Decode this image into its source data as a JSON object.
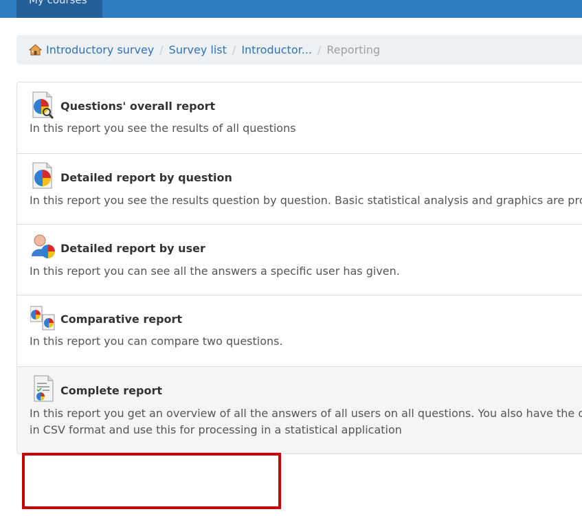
{
  "topbar": {
    "tab_label": "My courses"
  },
  "breadcrumb": {
    "items": [
      {
        "label": "Introductory survey",
        "icon": "home-icon"
      },
      {
        "label": "Survey list"
      },
      {
        "label": "Introductor..."
      },
      {
        "label": "Reporting"
      }
    ]
  },
  "reports": [
    {
      "icon": "pie-chart-magnifier-icon",
      "title": "Questions' overall report",
      "description": "In this report you see the results of all questions"
    },
    {
      "icon": "pie-chart-document-icon",
      "title": "Detailed report by question",
      "description": "In this report you see the results question by question. Basic statistical analysis and graphics are provid"
    },
    {
      "icon": "user-pie-chart-icon",
      "title": "Detailed report by user",
      "description": "In this report you can see all the answers a specific user has given."
    },
    {
      "icon": "compare-charts-icon",
      "title": "Comparative report",
      "description": "In this report you can compare two questions."
    },
    {
      "icon": "complete-report-document-icon",
      "title": "Complete report",
      "description_line1": "In this report you get an overview of all the answers of all users on all questions. You also have the opti",
      "description_line2": "in CSV format and use this for processing in a statistical application"
    }
  ],
  "colors": {
    "topbar": "#2e7bbf",
    "link": "#2e72b8",
    "highlight_box": "#cc0000"
  }
}
